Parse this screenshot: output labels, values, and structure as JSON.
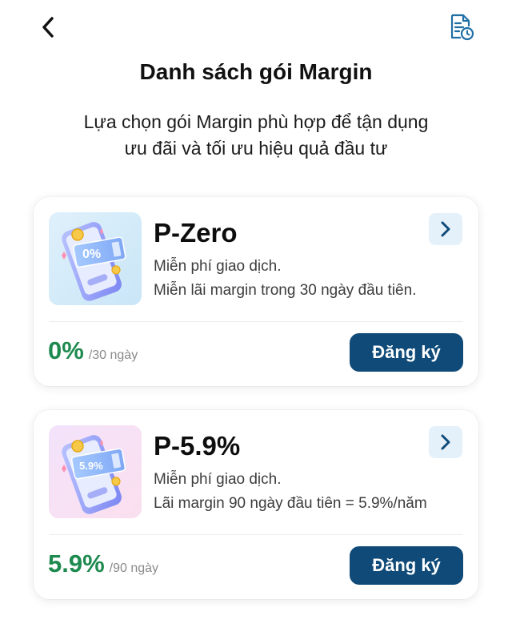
{
  "header": {
    "back_icon": "chevron-left-icon",
    "history_icon": "document-clock-icon",
    "title": "Danh sách gói Margin",
    "subtitle_line1": "Lựa chọn gói Margin phù hợp để tận dụng",
    "subtitle_line2": "ưu đãi và tối ưu hiệu quả đầu tư"
  },
  "packages": [
    {
      "name": "P-Zero",
      "desc_line1": "Miễn phí giao dịch.",
      "desc_line2": "Miễn lãi margin trong 30 ngày đầu tiên.",
      "thumb_text": "0%",
      "rate": "0%",
      "period": "/30 ngày",
      "button": "Đăng ký"
    },
    {
      "name": "P-5.9%",
      "desc_line1": "Miễn phí giao dịch.",
      "desc_line2": "Lãi margin 90 ngày đầu tiên = 5.9%/năm",
      "thumb_text": "5.9%",
      "rate": "5.9%",
      "period": "/90 ngày",
      "button": "Đăng ký"
    }
  ],
  "colors": {
    "primary": "#0f4a78",
    "rate_green": "#1e8a4f",
    "arrow_bg": "#e4f1fa",
    "icon_blue": "#1f6fa5"
  }
}
